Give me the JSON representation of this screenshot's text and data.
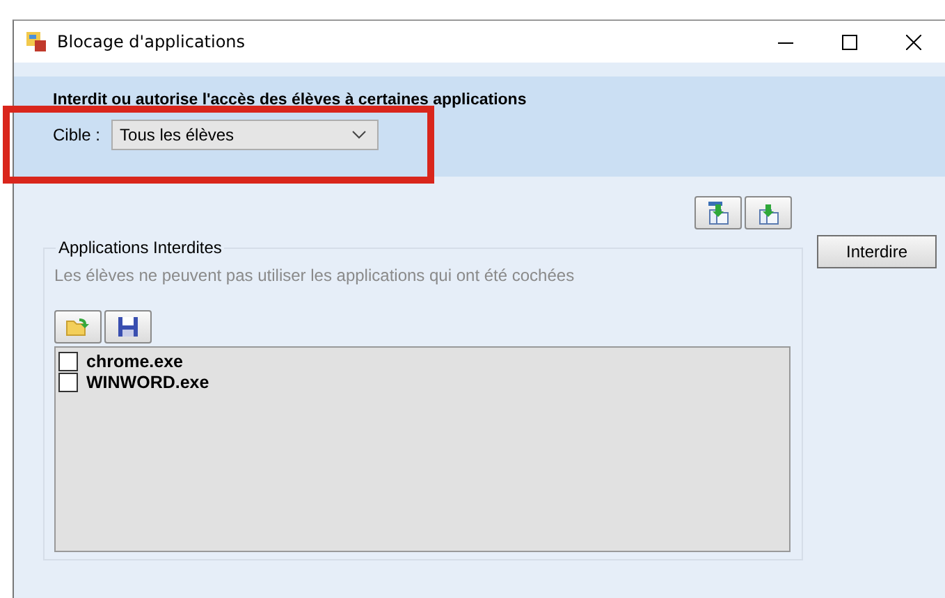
{
  "window": {
    "title": "Blocage d'applications"
  },
  "header": {
    "text": "Interdit ou autorise l'accès des élèves à certaines applications",
    "target_label": "Cible :",
    "target_value": "Tous les élèves",
    "highlighted": true
  },
  "group": {
    "title": "Applications Interdites",
    "hint": "Les élèves ne peuvent pas utiliser les applications qui ont été cochées",
    "items": [
      {
        "label": "chrome.exe",
        "checked": false
      },
      {
        "label": "WINWORD.exe",
        "checked": false
      }
    ]
  },
  "buttons": [
    "Interdire"
  ]
}
